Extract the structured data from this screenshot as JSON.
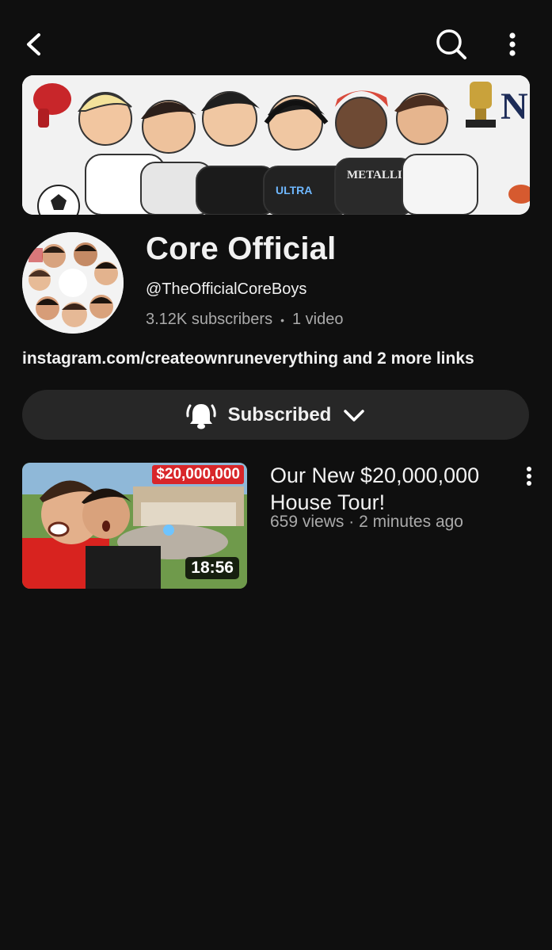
{
  "header": {
    "back_icon": "chevron-left-icon",
    "search_icon": "search-icon",
    "more_icon": "more-vertical-icon"
  },
  "channel": {
    "name": "Core Official",
    "handle": "@TheOfficialCoreBoys",
    "subscribers": "3.12K subscribers",
    "separator": "•",
    "video_count": "1 video",
    "link_text": "instagram.com/createownruneverything",
    "more_links": "and 2 more links"
  },
  "subscribe_button": {
    "label": "Subscribed",
    "icon": "bell-icon",
    "dropdown_icon": "chevron-down-icon"
  },
  "videos": [
    {
      "title": "Our New $20,000,000 House Tour!",
      "views": "659 views",
      "separator": "·",
      "age": "2 minutes ago",
      "duration": "18:56",
      "thumbnail_tag": "$20,000,000"
    }
  ],
  "colors": {
    "background": "#0f0f0f",
    "button_bg": "#272727",
    "secondary_text": "#aaaaaa",
    "price_tag": "#d8262a"
  }
}
